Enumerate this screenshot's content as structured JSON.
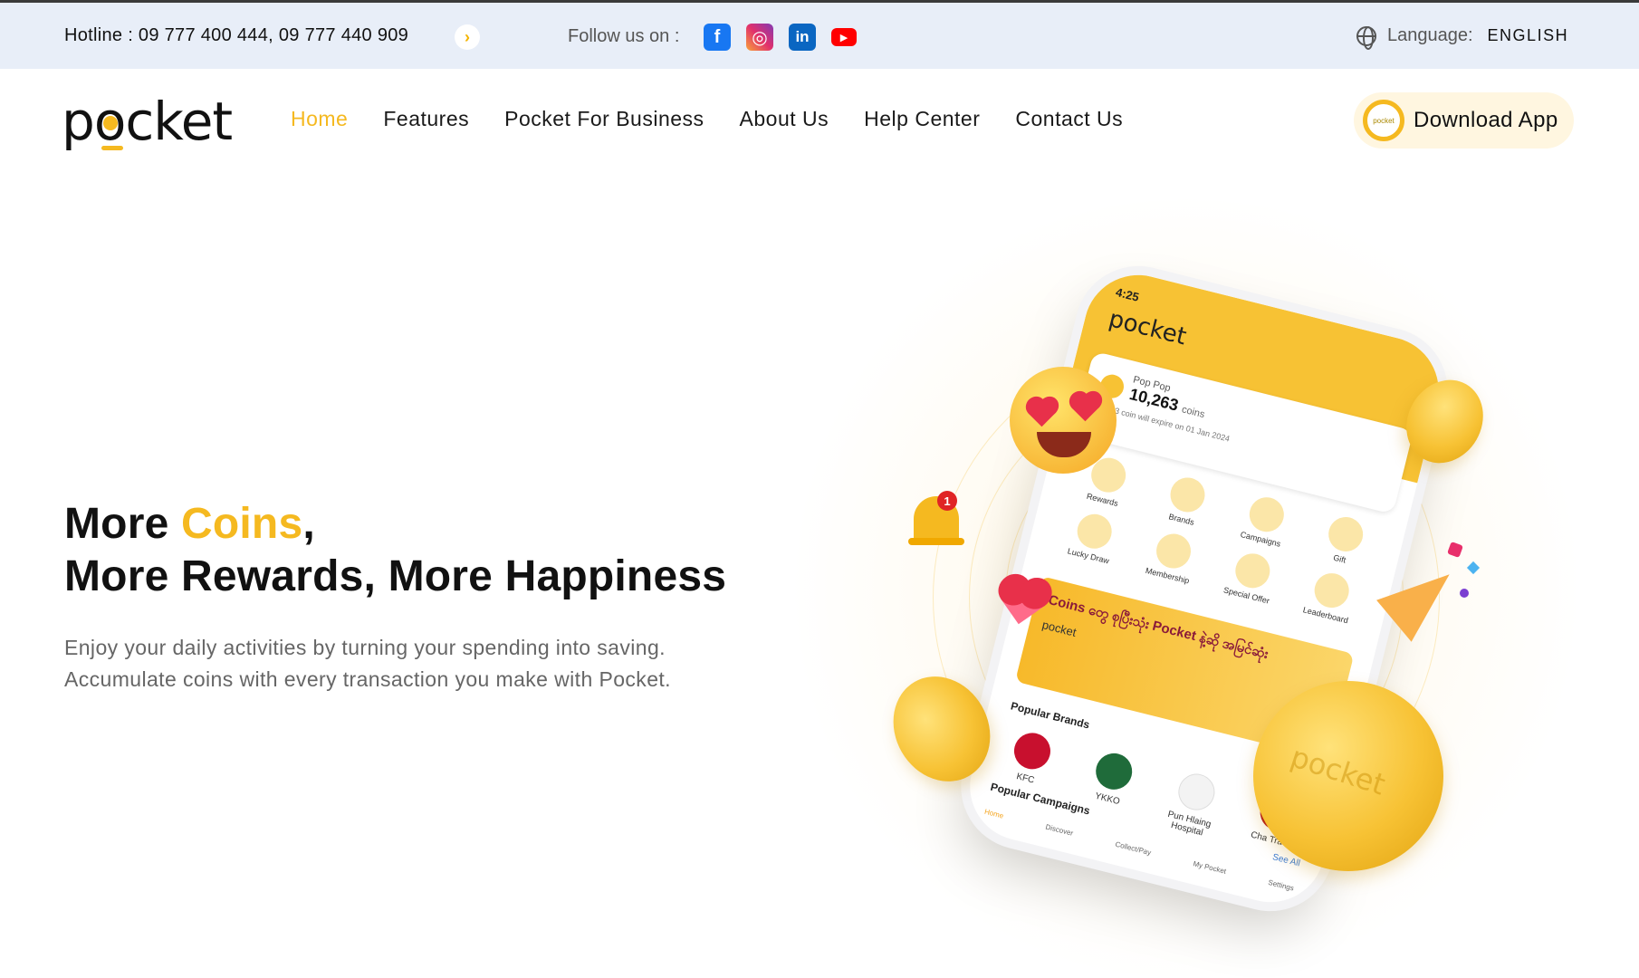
{
  "topbar": {
    "hotline": "Hotline : 09 777 400 444, 09 777 440 909",
    "follow_label": "Follow us on :",
    "social": [
      "facebook-icon",
      "instagram-icon",
      "linkedin-icon",
      "youtube-icon"
    ],
    "language_label": "Language:",
    "language_value": "ENGLISH"
  },
  "header": {
    "logo": "pocket",
    "nav": [
      "Home",
      "Features",
      "Pocket For Business",
      "About Us",
      "Help Center",
      "Contact Us"
    ],
    "active_nav": "Home",
    "download_label": "Download App",
    "download_icon_text": "pocket"
  },
  "hero": {
    "headline_line1_pre": "More ",
    "headline_line1_highlight": "Coins",
    "headline_line1_post": ",",
    "headline_line2": "More Rewards, More Happiness",
    "description_line1": "Enjoy your daily activities by turning your spending into saving.",
    "description_line2": "Accumulate coins with every transaction you make with Pocket."
  },
  "phone": {
    "time": "4:25",
    "app_logo": "pocket",
    "user_name": "Pop Pop",
    "coins": "10,263",
    "coins_unit": "coins",
    "expiry": "10,263 coin will expire on 01 Jan 2024",
    "menu": [
      "Rewards",
      "Brands",
      "Campaigns",
      "Gift",
      "Lucky Draw",
      "Membership",
      "Special Offer",
      "Leaderboard"
    ],
    "banner_text": "Coins တွေ စုပြီးသုံး Pocket နဲ့ဆို အမြင်ဆုံး",
    "banner_logo": "pocket",
    "popular_brands_label": "Popular Brands",
    "see_all": "See All",
    "brands": [
      "KFC",
      "YKKO",
      "Pun Hlaing Hospital",
      "Cha Tra M"
    ],
    "popular_campaigns_label": "Popular Campaigns",
    "tabs": [
      "Home",
      "Discover",
      "Collect/Pay",
      "My Pocket",
      "Settings"
    ]
  },
  "notification_count": "1",
  "coin_text": "pocket",
  "colors": {
    "accent": "#f5b920",
    "topbar_bg": "#e8eef8",
    "text": "#111111",
    "muted": "#666666"
  }
}
